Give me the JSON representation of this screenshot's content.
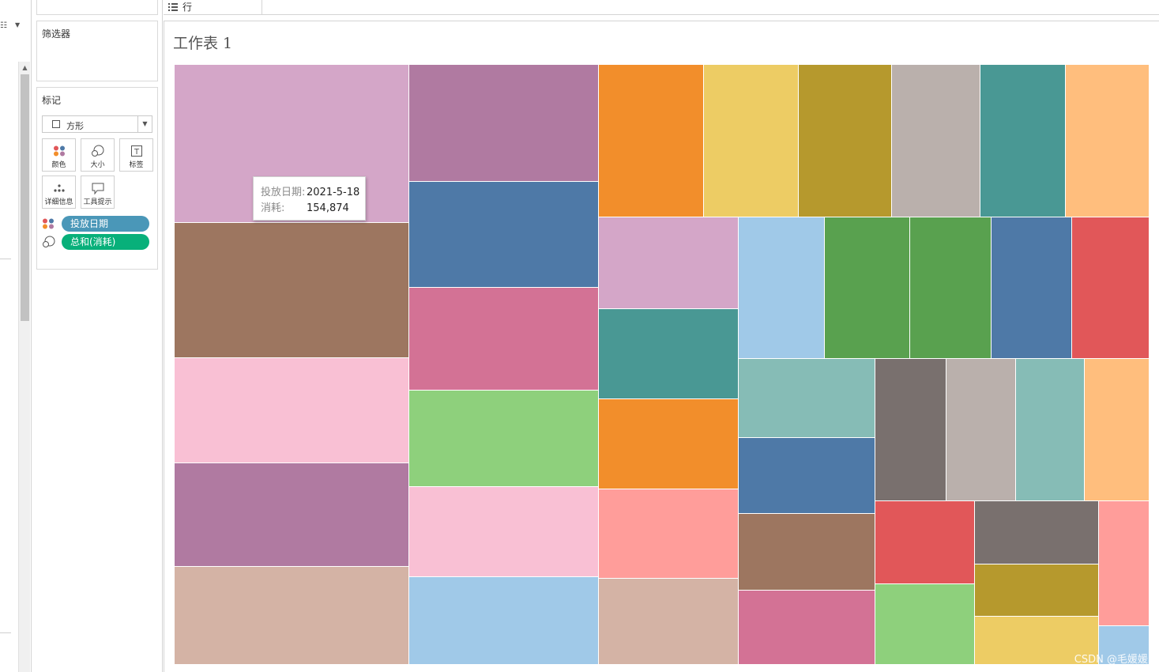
{
  "shelf": {
    "rows_label": "行"
  },
  "panes": {
    "filters_title": "筛选器",
    "marks_title": "标记",
    "mark_type": "方形",
    "buttons": [
      {
        "label": "颜色",
        "icon": "color-dots-icon"
      },
      {
        "label": "大小",
        "icon": "size-icon"
      },
      {
        "label": "标签",
        "icon": "text-label-icon"
      },
      {
        "label": "详细信息",
        "icon": "detail-dots-icon"
      },
      {
        "label": "工具提示",
        "icon": "tooltip-bubble-icon"
      }
    ],
    "pills": [
      {
        "label": "投放日期",
        "icon": "color-dots-icon",
        "color": "#4a97b8"
      },
      {
        "label": "总和(消耗)",
        "icon": "size-icon",
        "color": "#08b07a"
      }
    ]
  },
  "sheet": {
    "title": "工作表 1"
  },
  "tooltip": {
    "row1_key": "投放日期:",
    "row1_value": "2021-5-18",
    "row2_key": "消耗:",
    "row2_value": "154,874"
  },
  "watermark": "CSDN @毛媛媛",
  "chart_data": {
    "type": "treemap",
    "size_measure": "总和(消耗)",
    "color_dimension": "投放日期",
    "labeled_points": [
      {
        "投放日期": "2021-5-18",
        "消耗": 154874
      }
    ],
    "tile_colors": [
      "#d4a6c8",
      "#9d7660",
      "#f9c0d4",
      "#b07aa1",
      "#d4b3a5",
      "#b07aa1",
      "#4e79a7",
      "#d37295",
      "#8ed07c",
      "#f9c0d4",
      "#a0c9e8",
      "#f28e2b",
      "#edcc64",
      "#b6992d",
      "#bab0ac",
      "#499894",
      "#ffbe7d",
      "#d4a6c8",
      "#499894",
      "#f28e2b",
      "#ff9d9a",
      "#d4b3a5",
      "#a0c9e8",
      "#59a14f",
      "#59a14f",
      "#4e79a7",
      "#e15759",
      "#86bcb6",
      "#4e79a7",
      "#9d7660",
      "#d37295",
      "#79706e",
      "#bab0ac",
      "#86bcb6",
      "#ffbe7d",
      "#e15759",
      "#8ed07c",
      "#79706e",
      "#b6992d",
      "#edcc64",
      "#ff9d9a",
      "#a0c9e8"
    ]
  }
}
